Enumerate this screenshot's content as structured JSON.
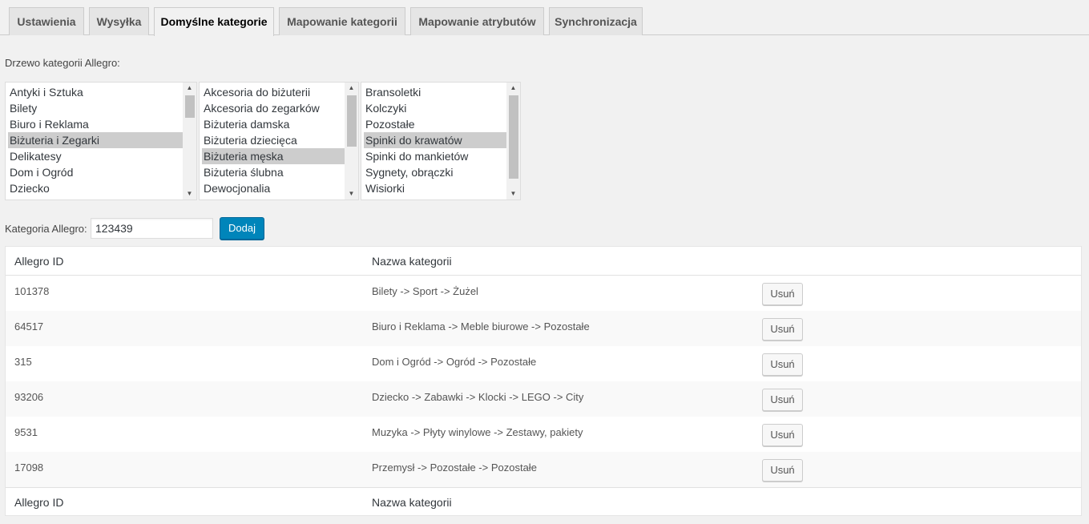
{
  "tabs": [
    {
      "label": "Ustawienia"
    },
    {
      "label": "Wysyłka"
    },
    {
      "label": "Domyślne kategorie"
    },
    {
      "label": "Mapowanie kategorii"
    },
    {
      "label": "Mapowanie atrybutów"
    },
    {
      "label": "Synchronizacja"
    }
  ],
  "active_tab": "Domyślne kategorie",
  "tree": {
    "label": "Drzewo kategorii Allegro:",
    "lists": [
      {
        "options": [
          "Antyki i Sztuka",
          "Bilety",
          "Biuro i Reklama",
          "Biżuteria i Zegarki",
          "Delikatesy",
          "Dom i Ogród",
          "Dziecko"
        ],
        "selected": "Biżuteria i Zegarki"
      },
      {
        "options": [
          "Akcesoria do biżuterii",
          "Akcesoria do zegarków",
          "Biżuteria damska",
          "Biżuteria dziecięca",
          "Biżuteria męska",
          "Biżuteria ślubna",
          "Dewocjonalia"
        ],
        "selected": "Biżuteria męska"
      },
      {
        "options": [
          "Bransoletki",
          "Kolczyki",
          "Pozostałe",
          "Spinki do krawatów",
          "Spinki do mankietów",
          "Sygnety, obrączki",
          "Wisiorki"
        ],
        "selected": "Spinki do krawatów"
      }
    ]
  },
  "category_input": {
    "label": "Kategoria Allegro:",
    "value": "123439",
    "add_label": "Dodaj"
  },
  "table": {
    "headers": [
      "Allegro ID",
      "Nazwa kategorii"
    ],
    "delete_label": "Usuń",
    "rows": [
      {
        "id": "101378",
        "name": "Bilety -> Sport -> Żużel"
      },
      {
        "id": "64517",
        "name": "Biuro i Reklama -> Meble biurowe -> Pozostałe"
      },
      {
        "id": "315",
        "name": "Dom i Ogród -> Ogród -> Pozostałe"
      },
      {
        "id": "93206",
        "name": "Dziecko -> Zabawki -> Klocki -> LEGO -> City"
      },
      {
        "id": "9531",
        "name": "Muzyka -> Płyty winylowe -> Zestawy, pakiety"
      },
      {
        "id": "17098",
        "name": "Przemysł -> Pozostałe -> Pozostałe"
      }
    ]
  },
  "colors": {
    "primary_button": "#0085ba",
    "selected_option": "#cdcdcd",
    "page_background": "#f1f1f1"
  }
}
